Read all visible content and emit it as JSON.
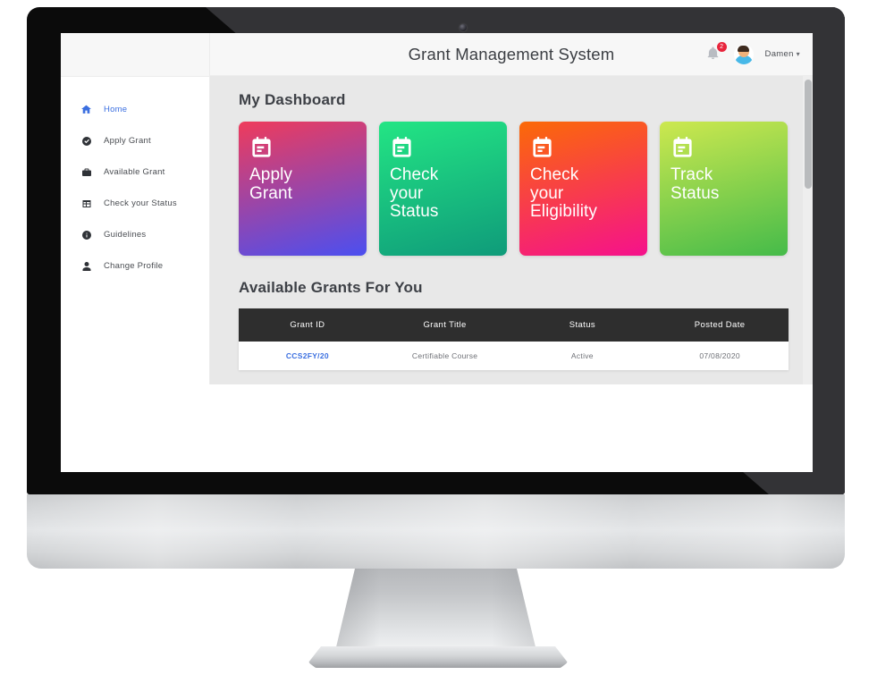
{
  "device": {
    "type": "desktop-monitor-mockup",
    "webcam_icon": "camera-dot"
  },
  "topbar": {
    "title": "Grant Management System",
    "notification_icon": "bell-icon",
    "notification_count": "2",
    "avatar_icon": "user-avatar",
    "user_name": "Damen",
    "caret_icon": "chevron-down-icon"
  },
  "sidebar": {
    "items": [
      {
        "label": "Home",
        "icon": "home-icon",
        "active": true
      },
      {
        "label": "Apply Grant",
        "icon": "check-circle-icon",
        "active": false
      },
      {
        "label": "Available Grant",
        "icon": "briefcase-icon",
        "active": false
      },
      {
        "label": "Check your Status",
        "icon": "table-icon",
        "active": false
      },
      {
        "label": "Guidelines",
        "icon": "info-circle-icon",
        "active": false
      },
      {
        "label": "Change Profile",
        "icon": "person-icon",
        "active": false
      }
    ]
  },
  "main": {
    "dashboard_title": "My Dashboard",
    "cards": [
      {
        "text": "Apply\nGrant",
        "icon": "calendar-note-icon",
        "gradient_from": "#ef3b5b",
        "gradient_to": "#4b4ff0"
      },
      {
        "text": "Check\nyour\nStatus",
        "icon": "calendar-note-icon",
        "gradient_from": "#23e584",
        "gradient_to": "#0f9b7a"
      },
      {
        "text": "Check\nyour\nEligibility",
        "icon": "calendar-note-icon",
        "gradient_from": "#fb6a07",
        "gradient_to": "#f5118c"
      },
      {
        "text": "Track\nStatus",
        "icon": "calendar-note-icon",
        "gradient_from": "#cde84f",
        "gradient_to": "#45bb4a"
      }
    ],
    "table_title": "Available Grants For You",
    "table": {
      "columns": [
        "Grant ID",
        "Grant Title",
        "Status",
        "Posted Date"
      ],
      "rows": [
        {
          "grant_id": "CCS2FY/20",
          "grant_title": "Certifiable Course",
          "status": "Active",
          "posted_date": "07/08/2020"
        }
      ]
    },
    "scrollbar": {
      "icon": "vertical-scrollbar"
    }
  },
  "colors": {
    "accent_link": "#3b6fe0",
    "badge": "#e8243c",
    "table_header_bg": "#2e2e2e",
    "content_bg": "#e8e8e8"
  }
}
